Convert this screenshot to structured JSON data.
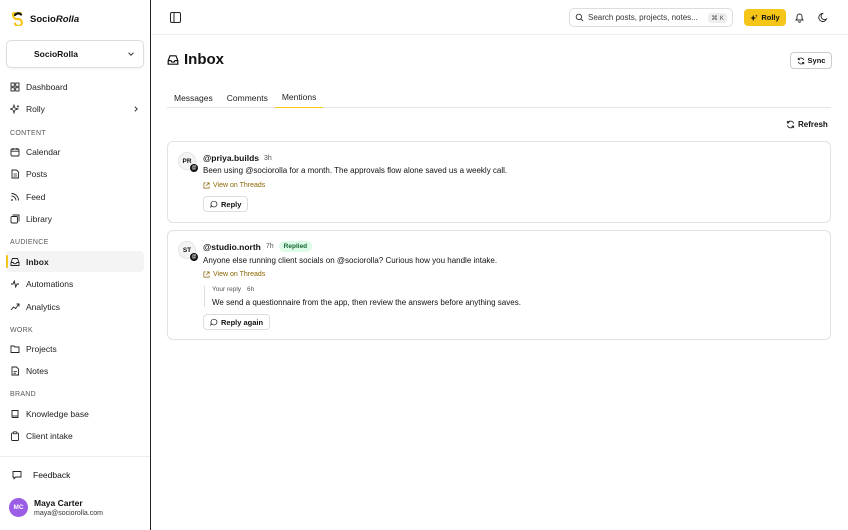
{
  "brand": {
    "name_prefix": "Socio",
    "name_suffix": "Rolla"
  },
  "workspace": {
    "name": "SocioRolla"
  },
  "sidebar": {
    "items": [
      {
        "label": "Dashboard"
      },
      {
        "label": "Rolly"
      },
      {
        "label": "Calendar"
      },
      {
        "label": "Posts"
      },
      {
        "label": "Feed"
      },
      {
        "label": "Library"
      },
      {
        "label": "Inbox"
      },
      {
        "label": "Automations"
      },
      {
        "label": "Analytics"
      },
      {
        "label": "Projects"
      },
      {
        "label": "Notes"
      },
      {
        "label": "Knowledge base"
      },
      {
        "label": "Client intake"
      }
    ],
    "sections": {
      "content": "CONTENT",
      "audience": "AUDIENCE",
      "work": "WORK",
      "brand": "BRAND"
    },
    "feedback": "Feedback",
    "active_item": "Inbox"
  },
  "user": {
    "initials": "MC",
    "name": "Maya Carter",
    "email": "maya@sociorolla.com"
  },
  "topbar": {
    "search_placeholder": "Search posts, projects, notes...",
    "search_shortcut": "⌘ K",
    "rolly_label": "Rolly"
  },
  "page": {
    "title": "Inbox",
    "sync_label": "Sync",
    "refresh_label": "Refresh"
  },
  "tabs": [
    {
      "label": "Messages"
    },
    {
      "label": "Comments"
    },
    {
      "label": "Mentions"
    }
  ],
  "active_tab": "Mentions",
  "mentions": [
    {
      "initials": "PR",
      "handle": "@priya.builds",
      "time": "3h",
      "text": "Been using @sociorolla for a month. The approvals flow alone saved us a weekly call.",
      "link": "View on Threads",
      "action": "Reply"
    },
    {
      "initials": "ST",
      "handle": "@studio.north",
      "time": "7h",
      "badge": "Replied",
      "text": "Anyone else running client socials on @sociorolla? Curious how you handle intake.",
      "link": "View on Threads",
      "reply_label": "Your reply",
      "reply_time": "6h",
      "reply_text": "We send a questionnaire from the app, then review the answers before anything saves.",
      "action": "Reply again"
    }
  ],
  "colors": {
    "accent": "#f5c518",
    "replied_bg": "#dcfce7",
    "replied_text": "#166534",
    "avatar": "#9b5de5",
    "link": "#8a6500"
  }
}
